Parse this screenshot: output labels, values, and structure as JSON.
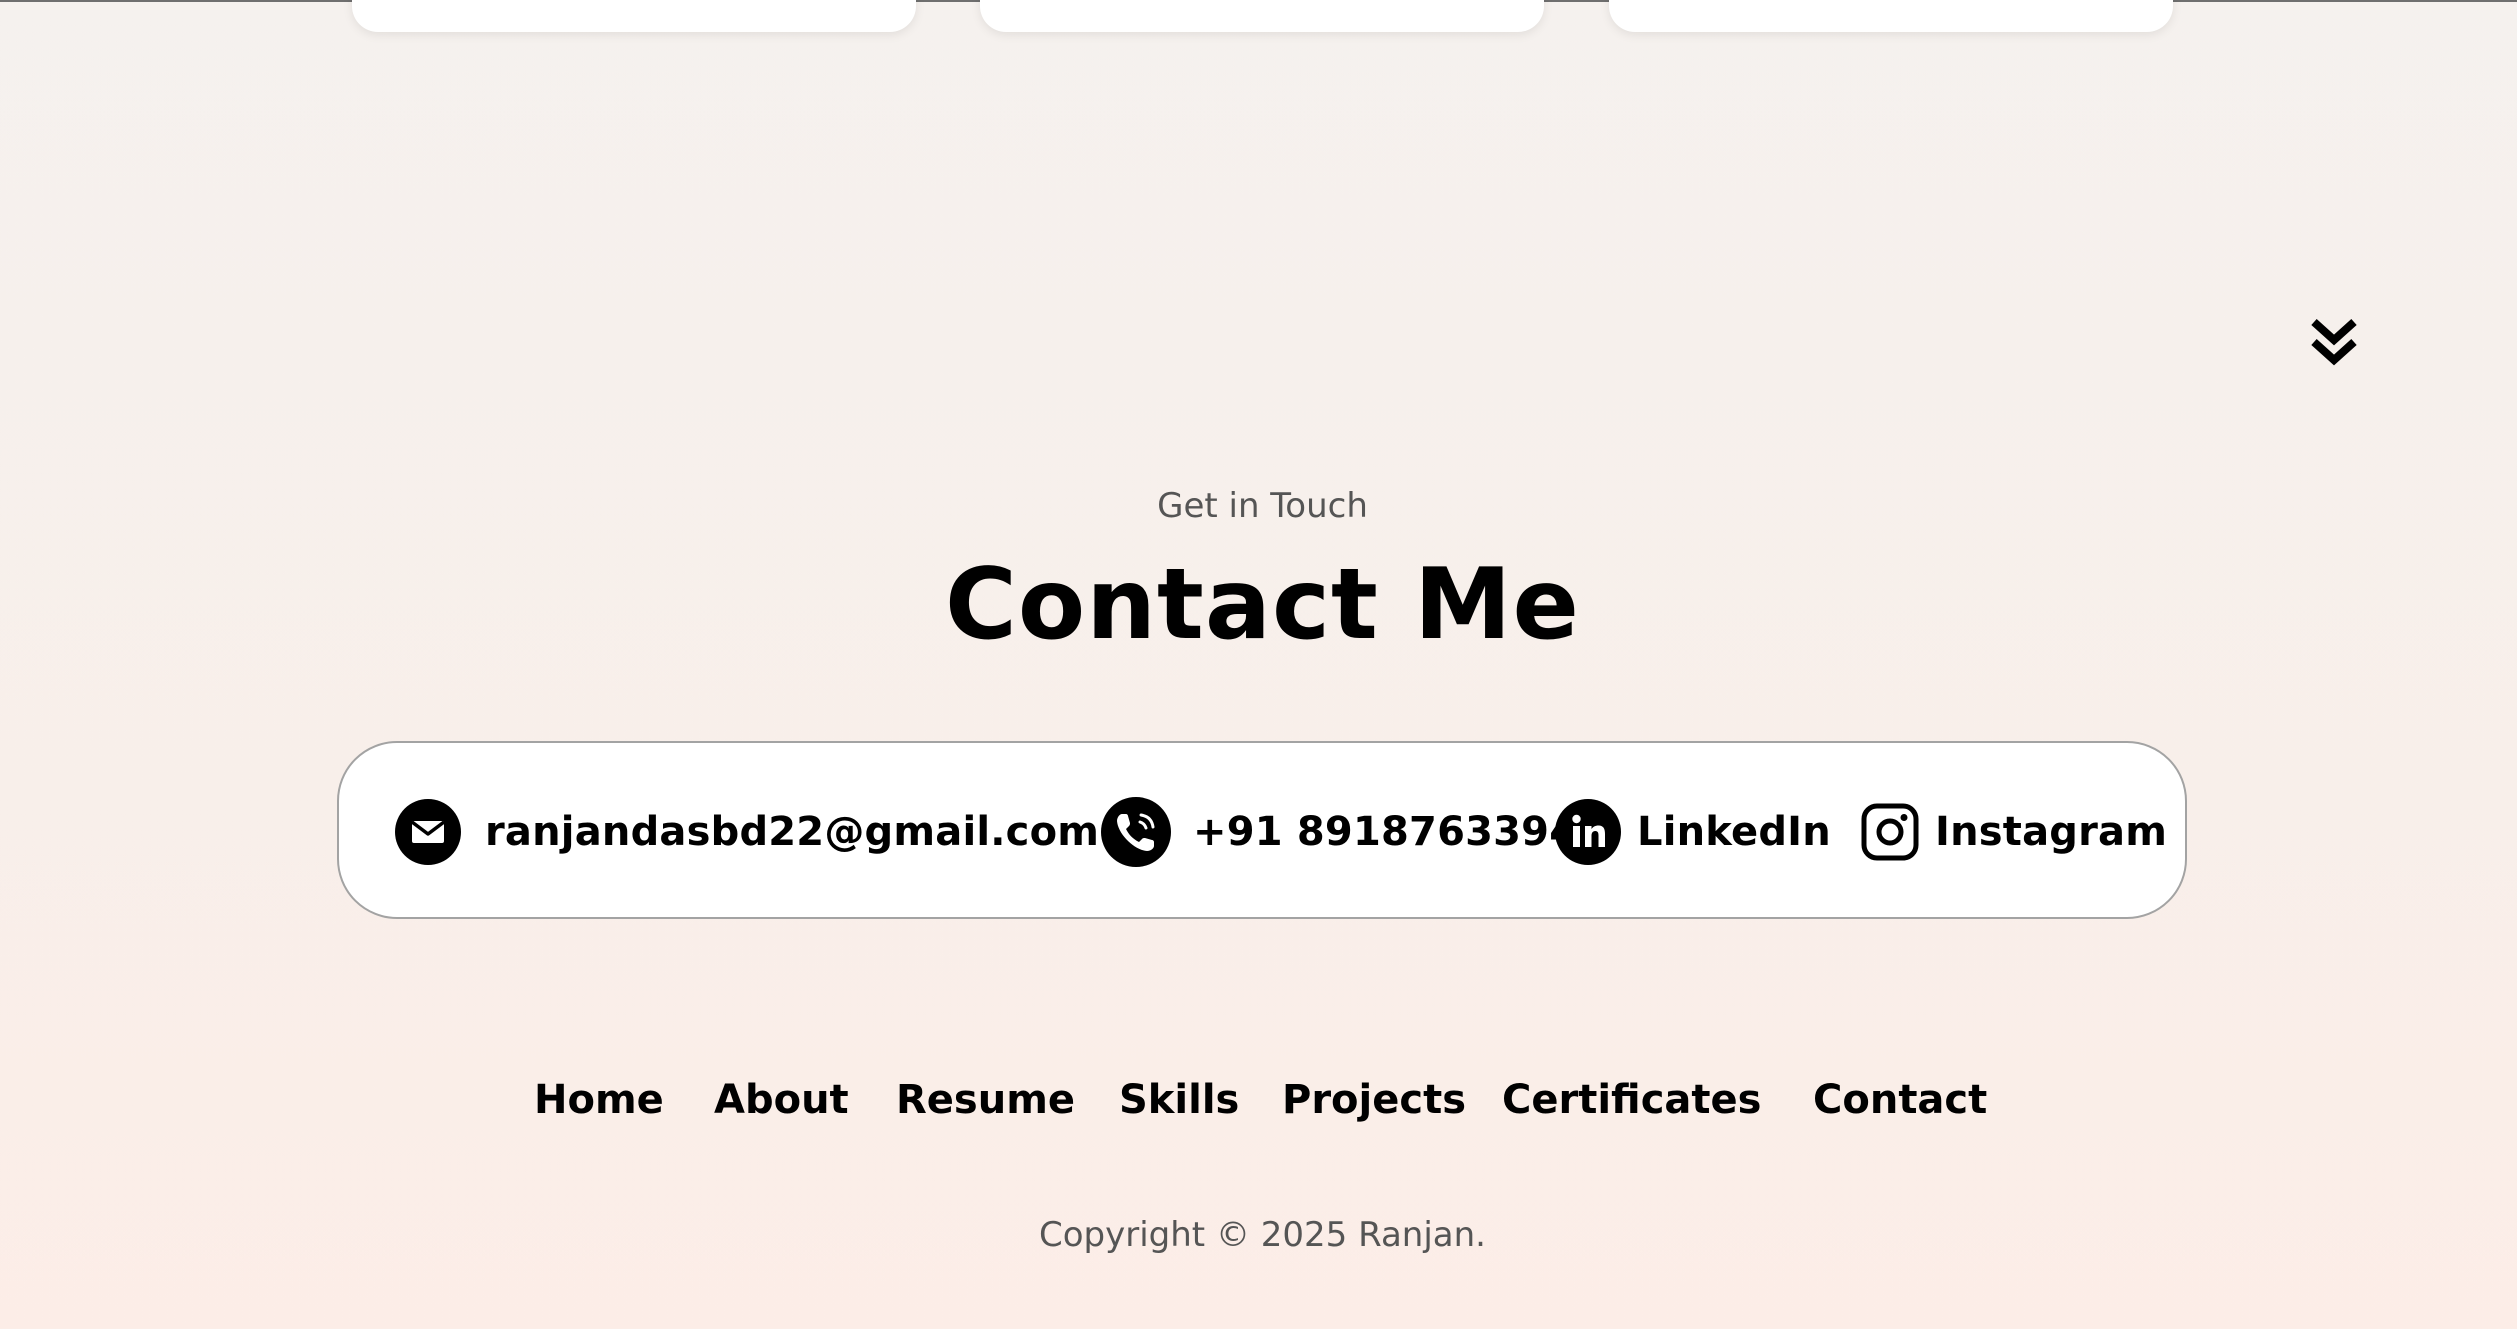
{
  "section": {
    "eyebrow": "Get in Touch",
    "title": "Contact Me"
  },
  "contacts": {
    "email": {
      "label": "ranjandasbd22@gmail.com",
      "icon": "mail-icon"
    },
    "phone": {
      "label": "+91 8918763394",
      "icon": "phone-icon"
    },
    "linkedin": {
      "label": "LinkedIn",
      "icon": "linkedin-icon"
    },
    "instagram": {
      "label": "Instagram",
      "icon": "instagram-icon"
    }
  },
  "nav": {
    "items": [
      "Home",
      "About",
      "Resume",
      "Skills",
      "Projects",
      "Certificates",
      "Contact"
    ]
  },
  "footer": {
    "copyright": "Copyright © 2025 Ranjan."
  },
  "colors": {
    "background_top": "#f5f1ee",
    "background_bottom": "#fcede7",
    "text_primary": "#000000",
    "text_muted": "#555555",
    "card_border": "#a3a3a3"
  },
  "icons": {
    "scroll": "double-chevron-down-icon"
  }
}
